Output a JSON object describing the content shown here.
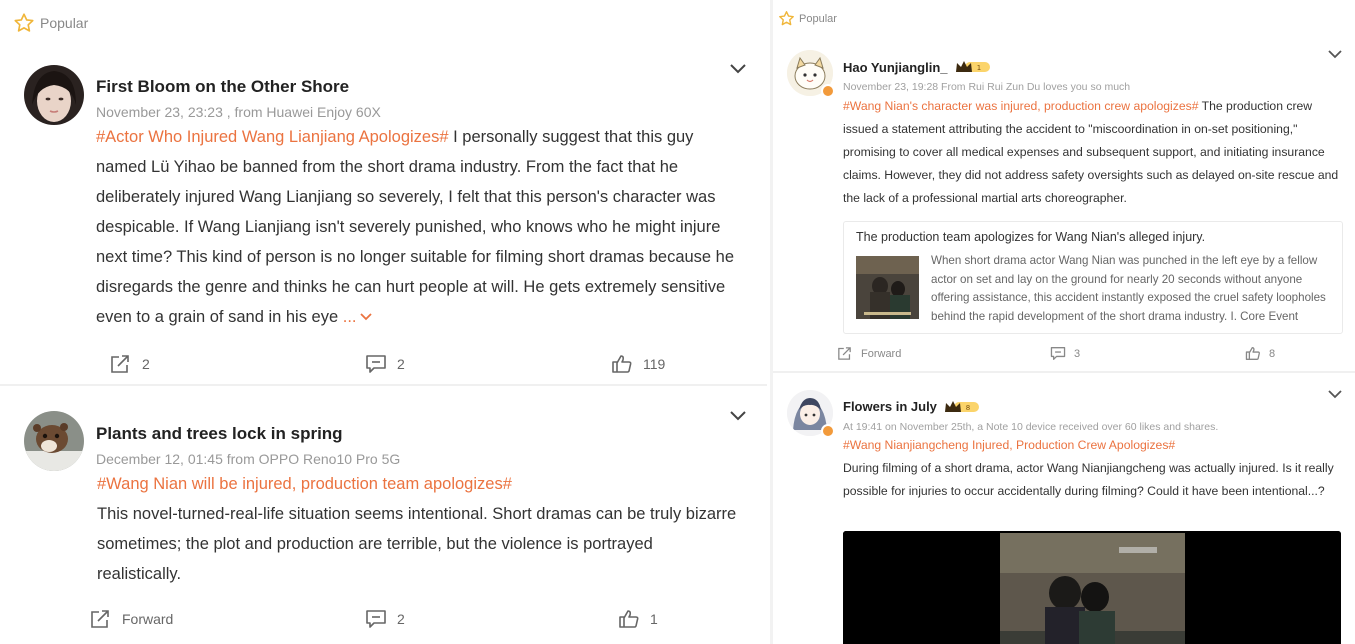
{
  "colors": {
    "accent": "#eb7340",
    "muted": "#999999",
    "star": "#f0b63a",
    "vip": "#f29a3b"
  },
  "left_pane": {
    "popular_label": "Popular",
    "posts": [
      {
        "author": "First Bloom on the Other Shore",
        "meta": "November 23, 23:23  , from Huawei Enjoy 60X",
        "hashtag": "#Actor Who Injured Wang Lianjiang Apologizes#",
        "text": " I personally suggest that this guy named Lü Yihao be banned from the short drama industry. From the fact that he deliberately injured Wang Lianjiang so severely, I felt that this person's character was despicable. If Wang Lianjiang isn't severely punished, who knows who he might injure next time? This kind of person is no longer suitable for filming short dramas because he disregards the genre and thinks he can hurt people at will. He gets extremely sensitive even to a grain of sand in his eye ",
        "more": "...",
        "forward": "2",
        "comments": "2",
        "likes": "119",
        "avatar_icon": "user-photo"
      },
      {
        "author": "Plants and trees lock in spring",
        "meta": "December 12, 01:45  from OPPO Reno10 Pro 5G",
        "hashtag": "#Wang Nian will be injured, production team apologizes#",
        "text": "This novel-turned-real-life situation seems intentional. Short dramas can be truly bizarre sometimes; the plot and production are terrible, but the violence is portrayed realistically.",
        "forward": "Forward",
        "comments": "2",
        "likes": "1",
        "avatar_icon": "animal-photo"
      }
    ]
  },
  "right_pane": {
    "popular_label": "Popular",
    "posts": [
      {
        "author": "Hao Yunjianglin_",
        "meta": "November 23, 19:28  From Rui Rui Zun Du loves you so much",
        "hashtag": "#Wang Nian's character was injured, production crew apologizes#",
        "text": " The production crew issued a statement attributing the accident to \"miscoordination in on-set positioning,\" promising to cover all medical expenses and subsequent support, and initiating insurance claims. However, they did not address safety oversights such as delayed on-site rescue and the lack of a professional martial arts choreographer.",
        "card_title": "The production team apologizes for Wang Nian's alleged injury.",
        "card_text": "When short drama actor Wang Nian was punched in the left eye by a fellow actor on set and lay on the ground for nearly 20 seconds without anyone offering assistance, this accident instantly exposed the cruel safety loopholes behind the rapid development of the short drama industry. I. Core Event",
        "forward": "Forward",
        "comments": "3",
        "likes": "8"
      },
      {
        "author": "Flowers in July",
        "meta": "At 19:41 on November 25th, a Note 10  device received over 60 likes and shares.",
        "hashtag": "#Wang Nianjiangcheng Injured, Production Crew Apologizes#",
        "text": "During filming of a short drama, actor Wang Nianjiangcheng was actually injured. Is it really possible for injuries to occur accidentally during filming? Could it have been intentional...?"
      }
    ]
  }
}
